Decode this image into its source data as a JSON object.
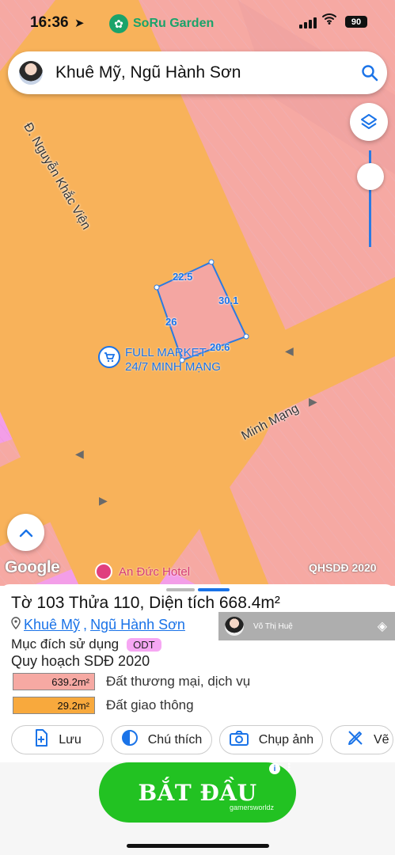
{
  "status_bar": {
    "time": "16:36",
    "app_name": "SoRu Garden",
    "battery": "90"
  },
  "search": {
    "query": "Khuê Mỹ, Ngũ Hành Sơn"
  },
  "map": {
    "street_1": "Đ. Nguyễn Khắc Viện",
    "street_2": "Minh Mạng",
    "poi_market_line1": "FULL MARKET",
    "poi_market_line2": "24/7 MINH MẠNG",
    "poi_hotel": "An Đức Hotel",
    "credit": "QHSDĐ 2020",
    "logo": "Google",
    "parcel_dims": [
      "22.5",
      "30.1",
      "26",
      "20.6"
    ]
  },
  "sheet": {
    "title": "Tờ 103 Thửa 110, Diện tích 668.4m²",
    "ward": "Khuê Mỹ",
    "district": "Ngũ Hành Sơn",
    "purpose_label": "Mục đích sử dụng",
    "purpose_code": "ODT",
    "plan_label": "Quy hoạch SDĐ 2020",
    "areas": [
      {
        "value": "639.2m²",
        "label": "Đất thương mại, dịch vụ",
        "color": "#f6a9a3"
      },
      {
        "value": "29.2m²",
        "label": "Đất giao thông",
        "color": "#f8a93d"
      }
    ],
    "actions": [
      {
        "label": "Lưu",
        "icon": "bookmark-add-icon"
      },
      {
        "label": "Chú thích",
        "icon": "legend-icon"
      },
      {
        "label": "Chụp ảnh",
        "icon": "camera-icon"
      },
      {
        "label": "Vẽ",
        "icon": "draw-icon"
      }
    ]
  },
  "overlay_user": {
    "name": "Võ Thị Huệ"
  },
  "ad": {
    "cta": "BẮT ĐẦU",
    "brand": "gamersworldz"
  },
  "colors": {
    "commercial": "#f6a9a3",
    "road": "#f8b25a",
    "residential": "#f39ee8",
    "accent": "#1a73e8"
  }
}
